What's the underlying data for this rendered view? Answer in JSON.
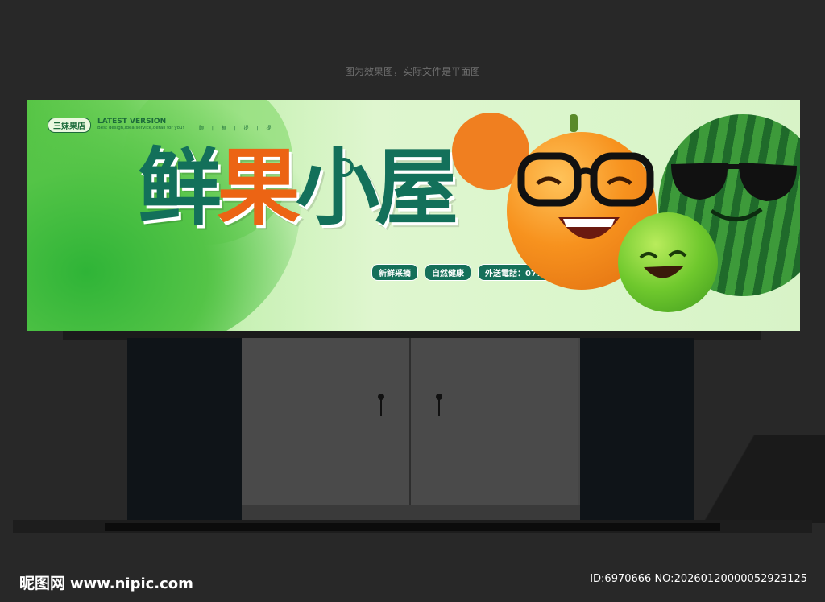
{
  "top_note": "图为效果图，实际文件是平面图",
  "banner": {
    "shop_name": "三妹果店",
    "latest": "LATEST VERSION",
    "tagline": "Best design,idea,service,detail for you!",
    "dots": "顾 | 桓 | 提 | 提",
    "title": [
      "鲜",
      "果",
      "小",
      "屋"
    ],
    "tags": [
      "新鲜采摘",
      "自然健康",
      "外送電話：0771-8888888"
    ]
  },
  "footer": {
    "brand": "昵图网",
    "url": "www.nipic.com",
    "id_text": "ID:6970666 NO:20260120000052923125"
  },
  "colors": {
    "title_green": "#13705a",
    "title_orange": "#ec6414",
    "background": "#282828"
  }
}
